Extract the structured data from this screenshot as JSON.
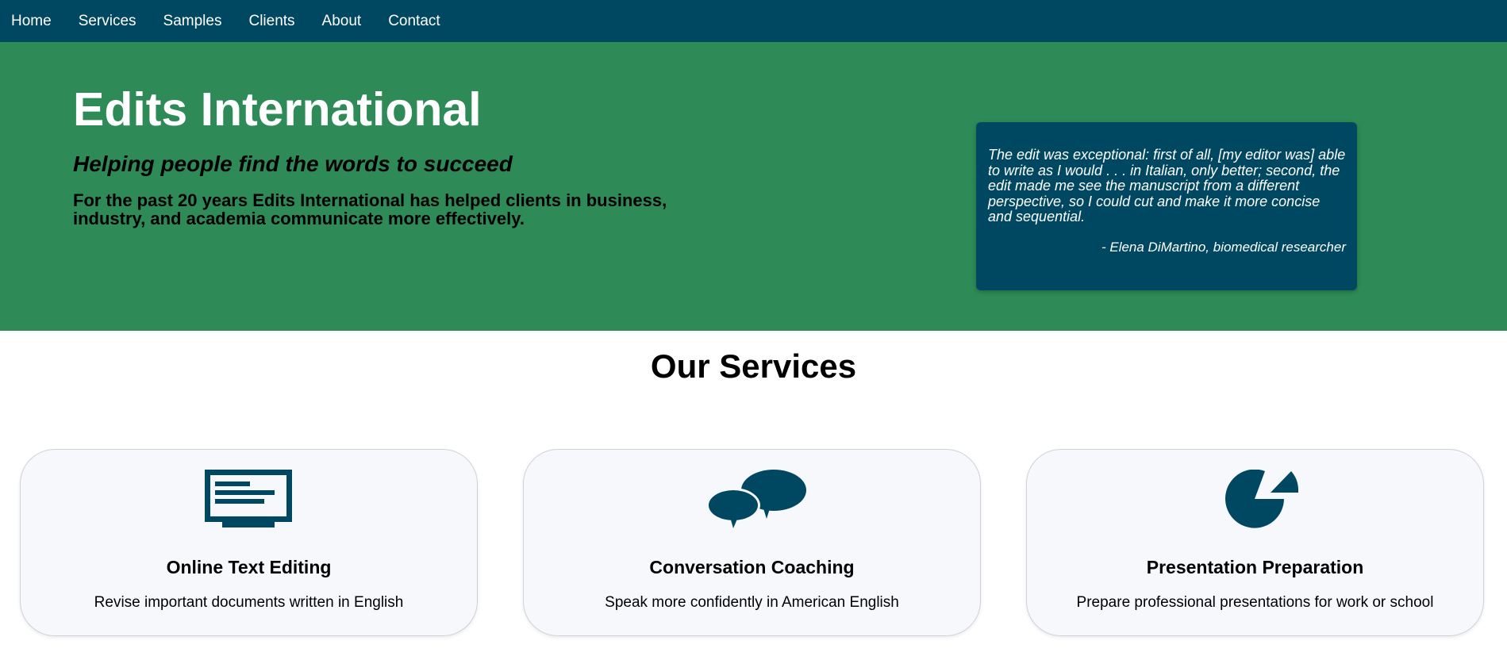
{
  "nav": {
    "items": [
      "Home",
      "Services",
      "Samples",
      "Clients",
      "About",
      "Contact"
    ]
  },
  "hero": {
    "title": "Edits International",
    "tagline": "Helping people find the words to succeed",
    "description": "For the past 20 years Edits International has helped clients in business, industry, and academia communicate more effectively."
  },
  "testimonial": {
    "quote": "The edit was exceptional: first of all, [my editor was] able to write as I would . . . in Italian, only better; second, the edit made me see the manuscript from a different perspective, so I could cut and make it more concise and sequential.",
    "author": "- Elena DiMartino, biomedical researcher"
  },
  "services": {
    "heading": "Our Services",
    "cards": [
      {
        "icon": "monitor-text-icon",
        "title": "Online Text Editing",
        "description": "Revise important documents written in English"
      },
      {
        "icon": "speech-bubbles-icon",
        "title": "Conversation Coaching",
        "description": "Speak more confidently in American English"
      },
      {
        "icon": "pie-chart-icon",
        "title": "Presentation Preparation",
        "description": "Prepare professional presentations for work or school"
      }
    ]
  },
  "colors": {
    "nav_bg": "#004862",
    "hero_bg": "#2e8b57",
    "quote_bg": "#004862",
    "icon": "#004862",
    "card_bg": "#f7f8fc"
  }
}
